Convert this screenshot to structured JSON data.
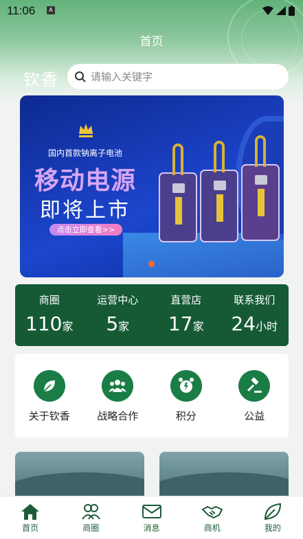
{
  "status_bar": {
    "time": "11:06"
  },
  "page_title": "首页",
  "brand": "钦香",
  "search": {
    "placeholder": "请输入关键字"
  },
  "banner": {
    "subtitle": "国内首款钠离子电池",
    "title_line1": "移动电源",
    "title_line2": "即将上市",
    "cta": "点击立即查看>>"
  },
  "stats": [
    {
      "label": "商圈",
      "value": "110",
      "unit": "家"
    },
    {
      "label": "运营中心",
      "value": "5",
      "unit": "家"
    },
    {
      "label": "直营店",
      "value": "17",
      "unit": "家"
    },
    {
      "label": "联系我们",
      "value": "24",
      "unit": "小时"
    }
  ],
  "menu": [
    {
      "label": "关于钦香",
      "icon": "leaf-icon"
    },
    {
      "label": "战略合作",
      "icon": "group-icon"
    },
    {
      "label": "积分",
      "icon": "alarm-clock-icon"
    },
    {
      "label": "公益",
      "icon": "gavel-icon"
    }
  ],
  "tabs": [
    {
      "label": "首页",
      "icon": "home-icon"
    },
    {
      "label": "商圈",
      "icon": "people-icon"
    },
    {
      "label": "消息",
      "icon": "mail-icon"
    },
    {
      "label": "商机",
      "icon": "handshake-icon"
    },
    {
      "label": "我的",
      "icon": "leaf-outline-icon"
    }
  ],
  "colors": {
    "primary": "#155a35",
    "accent": "#1a7d46",
    "banner_blue": "#1a3fc0"
  }
}
